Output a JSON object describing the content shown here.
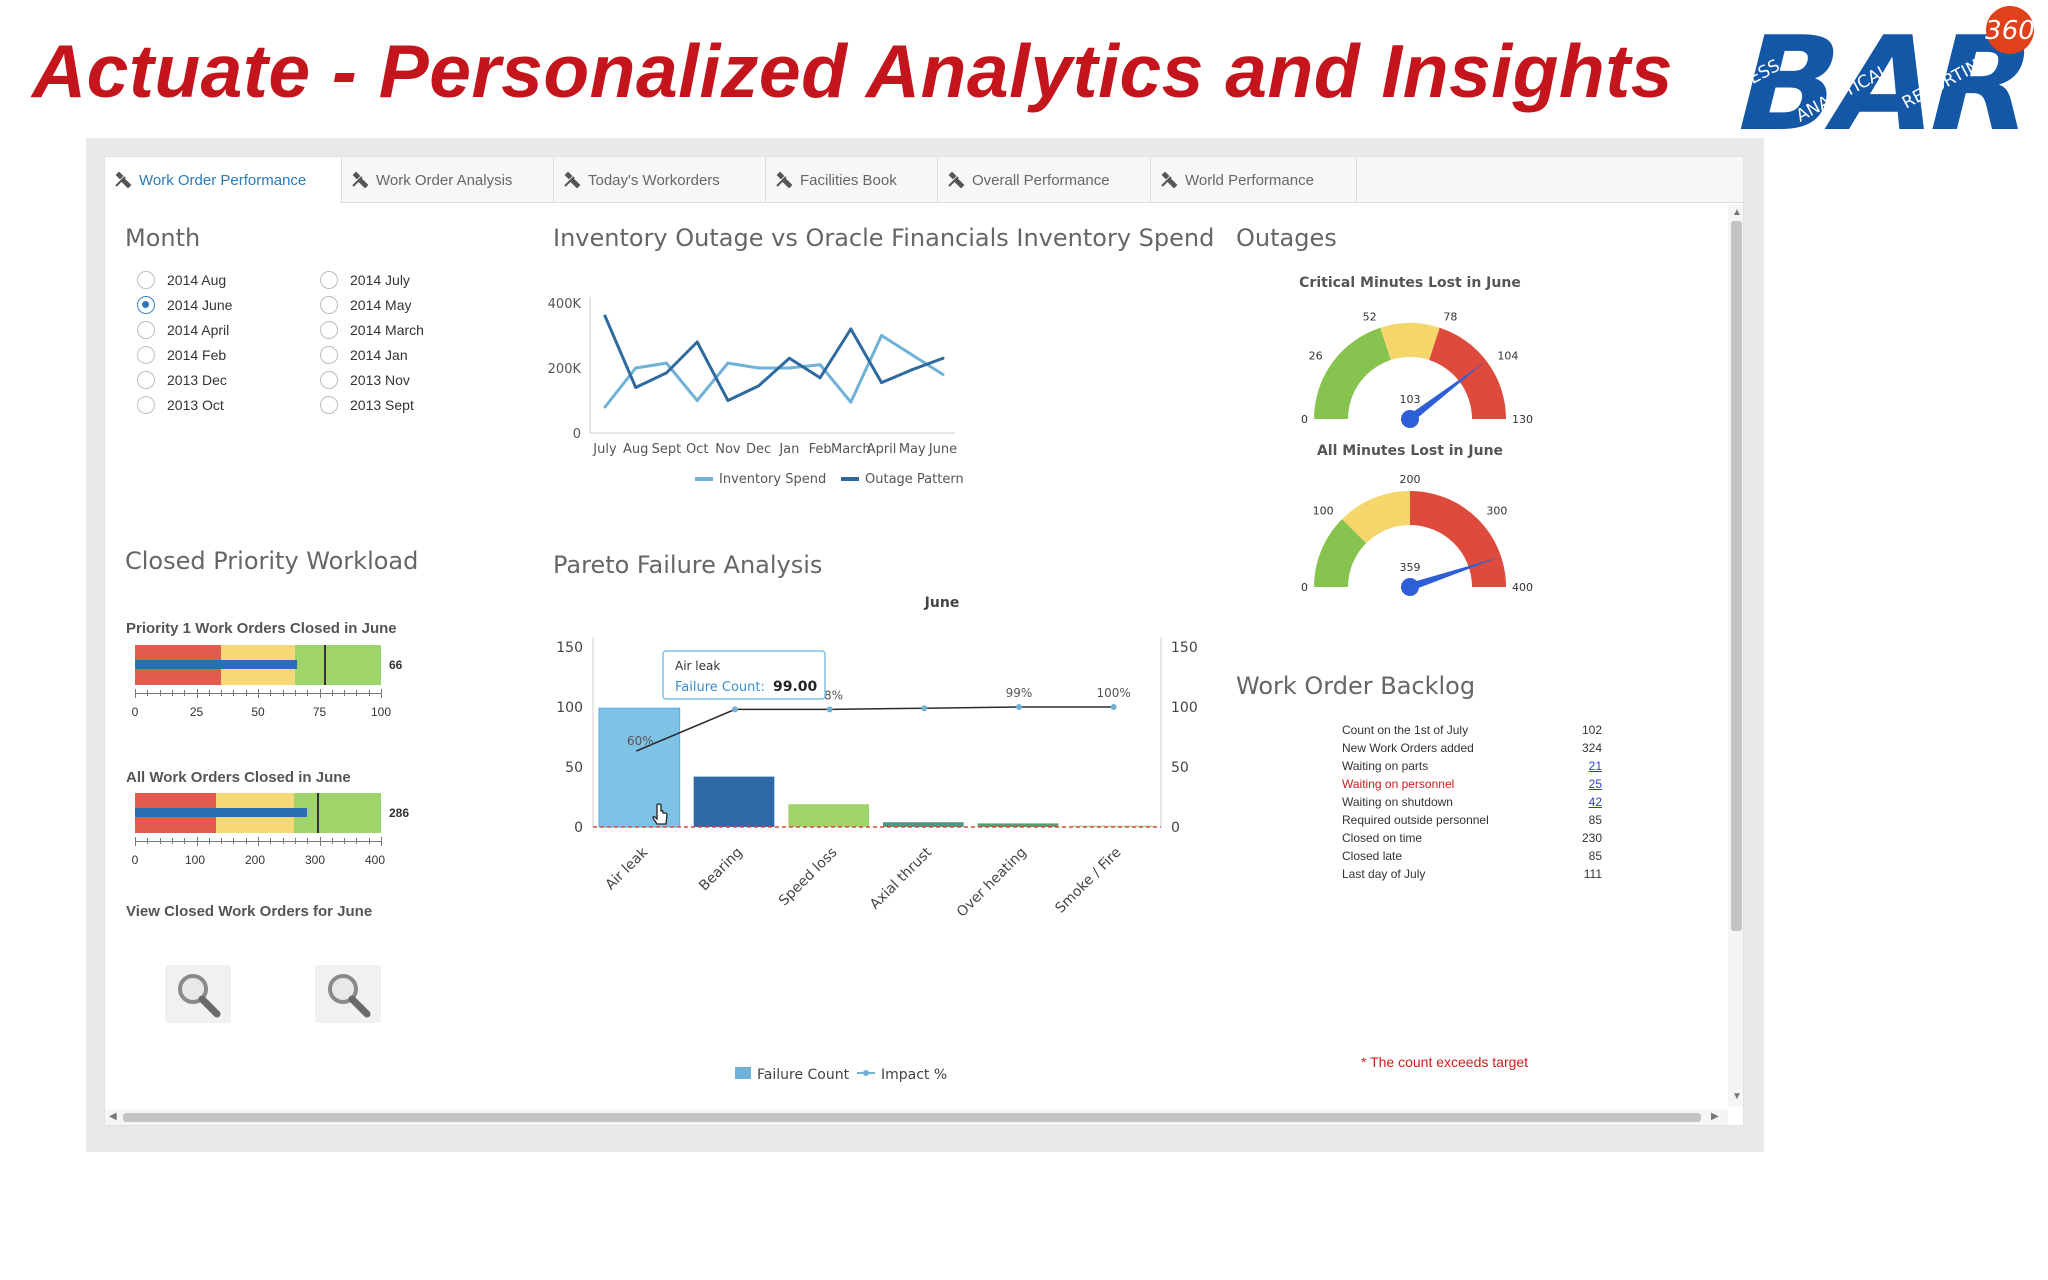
{
  "slide": {
    "title": "Actuate - Personalized Analytics and Insights",
    "logo": {
      "mark": "BAR",
      "badge": "360",
      "words": [
        "BUSINESS",
        "ANALYTICAL",
        "REPORTING"
      ],
      "colors": {
        "primary": "#1457a6",
        "badge": "#e0401a"
      }
    }
  },
  "tabs": [
    {
      "label": "Work Order Performance",
      "active": true,
      "icon": "tools-icon"
    },
    {
      "label": "Work Order Analysis",
      "active": false,
      "icon": "tools-icon"
    },
    {
      "label": "Today's Workorders",
      "active": false,
      "icon": "tools-icon"
    },
    {
      "label": "Facilities Book",
      "active": false,
      "icon": "tools-icon"
    },
    {
      "label": "Overall Performance",
      "active": false,
      "icon": "tools-icon"
    },
    {
      "label": "World Performance",
      "active": false,
      "icon": "tools-icon"
    }
  ],
  "month": {
    "title": "Month",
    "options": [
      {
        "label": "2014 Aug",
        "selected": false
      },
      {
        "label": "2014 July",
        "selected": false
      },
      {
        "label": "2014 June",
        "selected": true
      },
      {
        "label": "2014 May",
        "selected": false
      },
      {
        "label": "2014 April",
        "selected": false
      },
      {
        "label": "2014 March",
        "selected": false
      },
      {
        "label": "2014 Feb",
        "selected": false
      },
      {
        "label": "2014 Jan",
        "selected": false
      },
      {
        "label": "2013 Dec",
        "selected": false
      },
      {
        "label": "2013 Nov",
        "selected": false
      },
      {
        "label": "2013 Oct",
        "selected": false
      },
      {
        "label": "2013 Sept",
        "selected": false
      }
    ]
  },
  "workload": {
    "title": "Closed Priority Workload",
    "bullet1": {
      "title": "Priority 1 Work Orders Closed in June",
      "value": 66,
      "display": "66",
      "target": 77,
      "max": 100,
      "bands": [
        {
          "to": 35,
          "color": "#e15b4f"
        },
        {
          "to": 65,
          "color": "#f6d977"
        },
        {
          "to": 100,
          "color": "#9fd46a"
        }
      ],
      "ticks": [
        "0",
        "25",
        "50",
        "75",
        "100"
      ]
    },
    "bullet2": {
      "title": "All Work Orders Closed in June",
      "value": 286,
      "display": "286",
      "target": 303,
      "max": 410,
      "bands": [
        {
          "to": 135,
          "color": "#e15b4f"
        },
        {
          "to": 265,
          "color": "#f6d977"
        },
        {
          "to": 410,
          "color": "#9fd46a"
        }
      ],
      "ticks": [
        "0",
        "100",
        "200",
        "300",
        "400"
      ]
    },
    "view_title": "View Closed Work Orders for June"
  },
  "inventory": {
    "title": "Inventory Outage vs Oracle Financials  Inventory Spend",
    "legend": [
      "Inventory Spend",
      "Outage Pattern"
    ]
  },
  "pareto": {
    "title": "Pareto Failure Analysis",
    "chart_title": "June",
    "legend": [
      "Failure Count",
      "Impact %"
    ],
    "tooltip": {
      "category": "Air leak",
      "label": "Failure Count:",
      "value": "99.00"
    }
  },
  "outages": {
    "title": "Outages",
    "gauge1": {
      "title": "Critical Minutes Lost in June",
      "value": 103,
      "display": "103",
      "min": 0,
      "max": 130,
      "bands": [
        {
          "from": 0,
          "to": 52,
          "color": "#86c44f"
        },
        {
          "from": 52,
          "to": 78,
          "color": "#f4d66b"
        },
        {
          "from": 78,
          "to": 130,
          "color": "#de4b3c"
        }
      ],
      "labels": [
        {
          "v": 0,
          "t": "0"
        },
        {
          "v": 26,
          "t": "26"
        },
        {
          "v": 52,
          "t": "52"
        },
        {
          "v": 78,
          "t": "78"
        },
        {
          "v": 104,
          "t": "104"
        },
        {
          "v": 130,
          "t": "130"
        }
      ]
    },
    "gauge2": {
      "title": "All Minutes Lost in June",
      "value": 359,
      "display": "359",
      "min": 0,
      "max": 400,
      "bands": [
        {
          "from": 0,
          "to": 100,
          "color": "#86c44f"
        },
        {
          "from": 100,
          "to": 200,
          "color": "#f4d66b"
        },
        {
          "from": 200,
          "to": 400,
          "color": "#de4b3c"
        }
      ],
      "labels": [
        {
          "v": 0,
          "t": "0"
        },
        {
          "v": 100,
          "t": "100"
        },
        {
          "v": 200,
          "t": "200"
        },
        {
          "v": 300,
          "t": "300"
        },
        {
          "v": 400,
          "t": "400"
        }
      ]
    }
  },
  "backlog": {
    "title": "Work Order Backlog",
    "rows": [
      {
        "label": "Count on the 1st of July",
        "value": "102",
        "link": false,
        "warn": false
      },
      {
        "label": "New Work Orders added",
        "value": "324",
        "link": false,
        "warn": false
      },
      {
        "label": "Waiting on parts",
        "value": "21",
        "link": true,
        "warn": false
      },
      {
        "label": "Waiting on personnel",
        "value": "25",
        "link": true,
        "warn": true
      },
      {
        "label": "Waiting on shutdown",
        "value": "42",
        "link": true,
        "warn": false
      },
      {
        "label": "Required outside personnel",
        "value": "85",
        "link": false,
        "warn": false
      },
      {
        "label": "Closed on time",
        "value": "230",
        "link": false,
        "warn": false
      },
      {
        "label": "Closed late",
        "value": "85",
        "link": false,
        "warn": false
      },
      {
        "label": "Last day of July",
        "value": "111",
        "link": false,
        "warn": false
      }
    ],
    "note": "* The count exceeds target"
  },
  "chart_data": [
    {
      "type": "line",
      "title": "Inventory Outage vs Oracle Financials  Inventory Spend",
      "categories": [
        "July",
        "Aug",
        "Sept",
        "Oct",
        "Nov",
        "Dec",
        "Jan",
        "Feb",
        "March",
        "April",
        "May",
        "June"
      ],
      "yticks": [
        "0",
        "200K",
        "400K"
      ],
      "ylim": [
        0,
        400000
      ],
      "series": [
        {
          "name": "Inventory Spend",
          "color": "#6fb1d7",
          "values": [
            80000,
            200000,
            215000,
            100000,
            215000,
            200000,
            200000,
            210000,
            95000,
            300000,
            240000,
            180000
          ]
        },
        {
          "name": "Outage Pattern",
          "color": "#2f6a9e",
          "values": [
            360000,
            140000,
            185000,
            280000,
            100000,
            145000,
            230000,
            170000,
            320000,
            155000,
            195000,
            230000
          ]
        }
      ],
      "legend_position": "bottom",
      "grid": false
    },
    {
      "type": "bar",
      "title": "June",
      "categories": [
        "Air leak",
        "Bearing",
        "Speed loss",
        "Axial thrust",
        "Over heating",
        "Smoke / Fire"
      ],
      "ylim": [
        0,
        150
      ],
      "yticks": [
        "0",
        "50",
        "100",
        "150"
      ],
      "y2ticks": [
        "0",
        "50",
        "100",
        "150"
      ],
      "series": [
        {
          "name": "Failure Count",
          "type": "bar",
          "values": [
            99,
            42,
            19,
            4,
            3,
            1
          ],
          "colors": [
            "#7ec2e6",
            "#2f6aa6",
            "#9fd46a",
            "#4a9a82",
            "#5a9e6f",
            "#a9cc7a"
          ]
        },
        {
          "name": "Impact %",
          "type": "line",
          "color": "#2a2a2a",
          "values": [
            60,
            98,
            98,
            99,
            100,
            100
          ],
          "labels": [
            "60%",
            "",
            "98%",
            "",
            "99%",
            "100%"
          ]
        }
      ],
      "legend_position": "bottom"
    },
    {
      "type": "gauge",
      "title": "Critical Minutes Lost in June",
      "value": 103,
      "min": 0,
      "max": 130
    },
    {
      "type": "gauge",
      "title": "All Minutes Lost in June",
      "value": 359,
      "min": 0,
      "max": 400
    }
  ]
}
